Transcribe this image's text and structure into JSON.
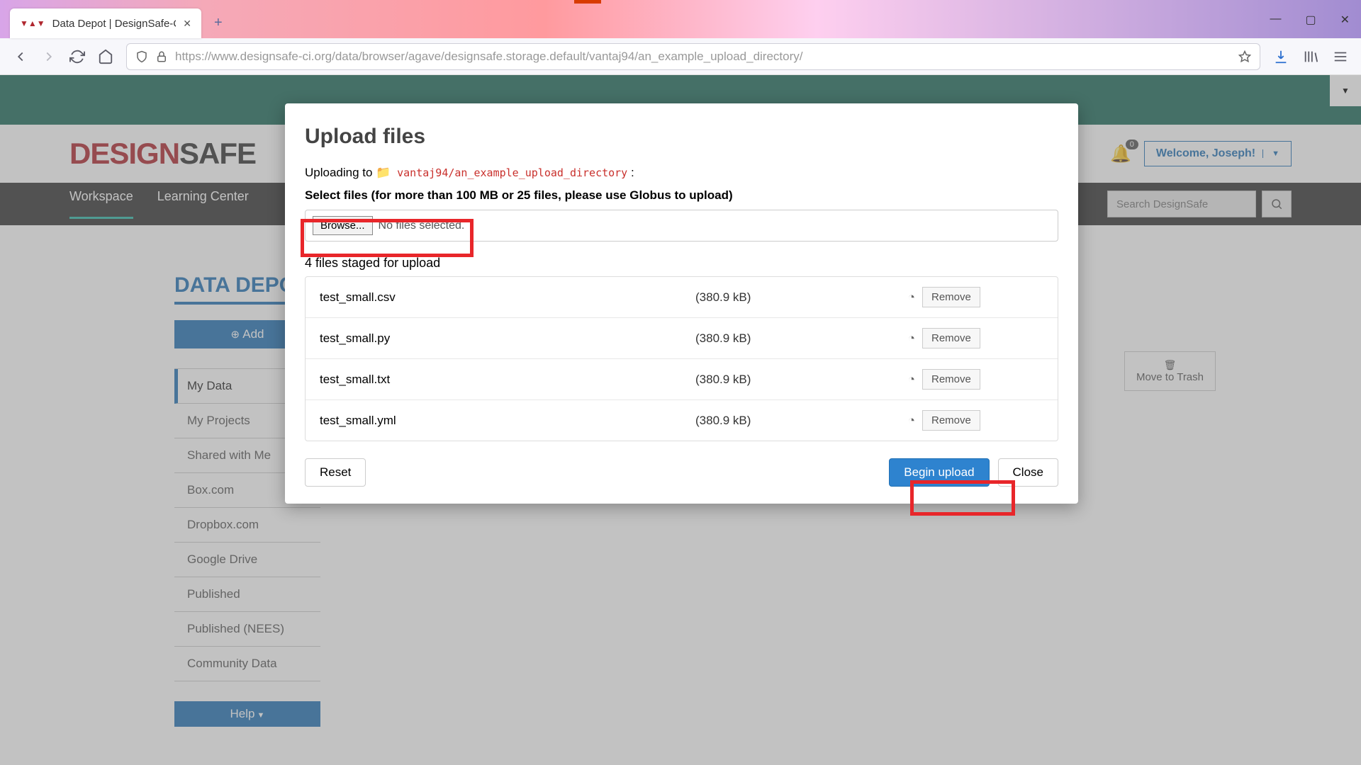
{
  "browser": {
    "tab_title": "Data Depot | DesignSafe-CI",
    "url": "https://www.designsafe-ci.org/data/browser/agave/designsafe.storage.default/vantaj94/an_example_upload_directory/"
  },
  "header": {
    "logo_red": "DESIGN",
    "logo_dark": "SAFE",
    "welcome": "Welcome, Joseph!",
    "badge": "0",
    "search_placeholder": "Search DesignSafe"
  },
  "nav": {
    "items": [
      "Workspace",
      "Learning Center"
    ]
  },
  "page": {
    "title": "DATA DEPOT",
    "add_btn": "Add",
    "help_btn": "Help",
    "move_trash": "Move to Trash",
    "sidebar": [
      "My Data",
      "My Projects",
      "Shared with Me",
      "Box.com",
      "Dropbox.com",
      "Google Drive",
      "Published",
      "Published (NEES)",
      "Community Data"
    ]
  },
  "modal": {
    "title": "Upload files",
    "uploading_to_label": "Uploading to",
    "dest_path": "vantaj94/an_example_upload_directory",
    "colon": " :",
    "select_files": "Select files (for more than 100 MB or 25 files, please use Globus to upload)",
    "browse": "Browse...",
    "file_status": "No files selected.",
    "staged_label": "4 files staged for upload",
    "files": [
      {
        "name": "test_small.csv",
        "size": "(380.9 kB)",
        "remove": "Remove"
      },
      {
        "name": "test_small.py",
        "size": "(380.9 kB)",
        "remove": "Remove"
      },
      {
        "name": "test_small.txt",
        "size": "(380.9 kB)",
        "remove": "Remove"
      },
      {
        "name": "test_small.yml",
        "size": "(380.9 kB)",
        "remove": "Remove"
      }
    ],
    "reset": "Reset",
    "begin": "Begin upload",
    "close": "Close"
  }
}
